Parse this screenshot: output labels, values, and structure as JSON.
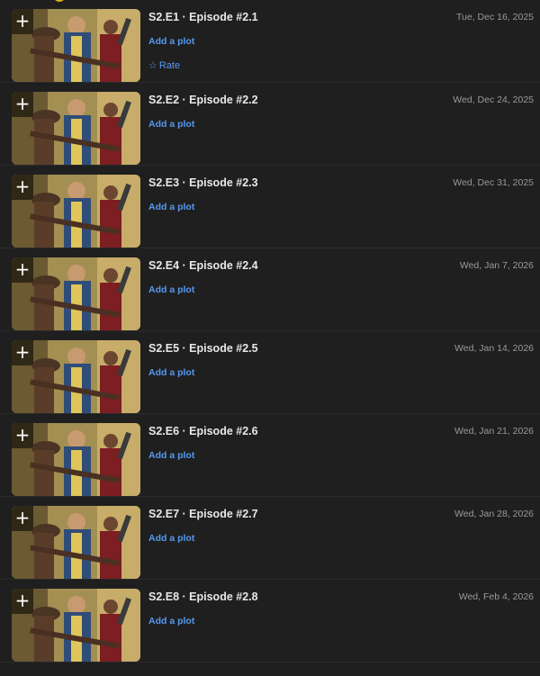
{
  "episodes": [
    {
      "title": "S2.E1 · Episode #2.1",
      "date": "Tue, Dec 16, 2025",
      "plot_label": "Add a plot",
      "rate_label": "Rate"
    },
    {
      "title": "S2.E2 · Episode #2.2",
      "date": "Wed, Dec 24, 2025",
      "plot_label": "Add a plot"
    },
    {
      "title": "S2.E3 · Episode #2.3",
      "date": "Wed, Dec 31, 2025",
      "plot_label": "Add a plot"
    },
    {
      "title": "S2.E4 · Episode #2.4",
      "date": "Wed, Jan 7, 2026",
      "plot_label": "Add a plot"
    },
    {
      "title": "S2.E5 · Episode #2.5",
      "date": "Wed, Jan 14, 2026",
      "plot_label": "Add a plot"
    },
    {
      "title": "S2.E6 · Episode #2.6",
      "date": "Wed, Jan 21, 2026",
      "plot_label": "Add a plot"
    },
    {
      "title": "S2.E7 · Episode #2.7",
      "date": "Wed, Jan 28, 2026",
      "plot_label": "Add a plot"
    },
    {
      "title": "S2.E8 · Episode #2.8",
      "date": "Wed, Feb 4, 2026",
      "plot_label": "Add a plot"
    }
  ],
  "icons": {
    "add": "plus-icon",
    "rate": "star-outline-icon"
  },
  "colors": {
    "background": "#1f1f1f",
    "link": "#5799ef",
    "date": "#9a9a9a"
  }
}
